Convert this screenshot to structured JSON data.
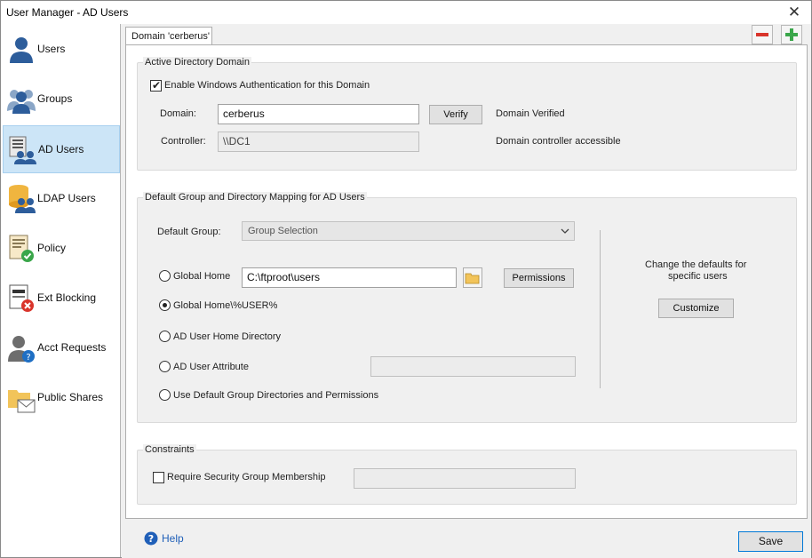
{
  "window": {
    "title": "User Manager - AD Users",
    "close_glyph": "✕"
  },
  "sidebar": {
    "items": [
      {
        "label": "Users",
        "icon": "users-icon"
      },
      {
        "label": "Groups",
        "icon": "groups-icon"
      },
      {
        "label": "AD Users",
        "icon": "ad-users-icon",
        "active": true
      },
      {
        "label": "LDAP Users",
        "icon": "ldap-users-icon"
      },
      {
        "label": "Policy",
        "icon": "policy-icon"
      },
      {
        "label": "Ext Blocking",
        "icon": "ext-blocking-icon"
      },
      {
        "label": "Acct Requests",
        "icon": "acct-requests-icon"
      },
      {
        "label": "Public Shares",
        "icon": "public-shares-icon"
      }
    ]
  },
  "tab": {
    "label": "Domain 'cerberus'"
  },
  "toolbar": {
    "remove_icon": "minus-icon",
    "add_icon": "plus-icon"
  },
  "ad_domain": {
    "title": "Active Directory Domain",
    "enable_label": "Enable Windows Authentication for this Domain",
    "enable_checked": true,
    "domain_label": "Domain:",
    "domain_value": "cerberus",
    "verify_label": "Verify",
    "domain_status": "Domain Verified",
    "controller_label": "Controller:",
    "controller_value": "\\\\DC1",
    "controller_status": "Domain controller accessible"
  },
  "mapping": {
    "title": "Default Group and Directory Mapping for AD Users",
    "default_group_label": "Default Group:",
    "default_group_value": "Group Selection",
    "options": {
      "global_home": "Global Home",
      "global_home_user": "Global Home\\%USER%",
      "ad_home": "AD User Home Directory",
      "ad_attribute": "AD User Attribute",
      "use_default": "Use Default Group Directories and Permissions"
    },
    "selected_option": "global_home_user",
    "global_home_path": "C:\\ftproot\\users",
    "permissions_label": "Permissions",
    "attribute_value": "",
    "side_text_line1": "Change the defaults for",
    "side_text_line2": "specific users",
    "customize_label": "Customize"
  },
  "constraints": {
    "title": "Constraints",
    "require_label": "Require Security Group Membership",
    "require_checked": false,
    "group_value": ""
  },
  "footer": {
    "help_label": "Help",
    "save_label": "Save"
  },
  "colors": {
    "accent_active": "#cce5f7",
    "minus_red": "#d9342b",
    "plus_green": "#3aa64a",
    "help_blue": "#1f5fb8"
  }
}
